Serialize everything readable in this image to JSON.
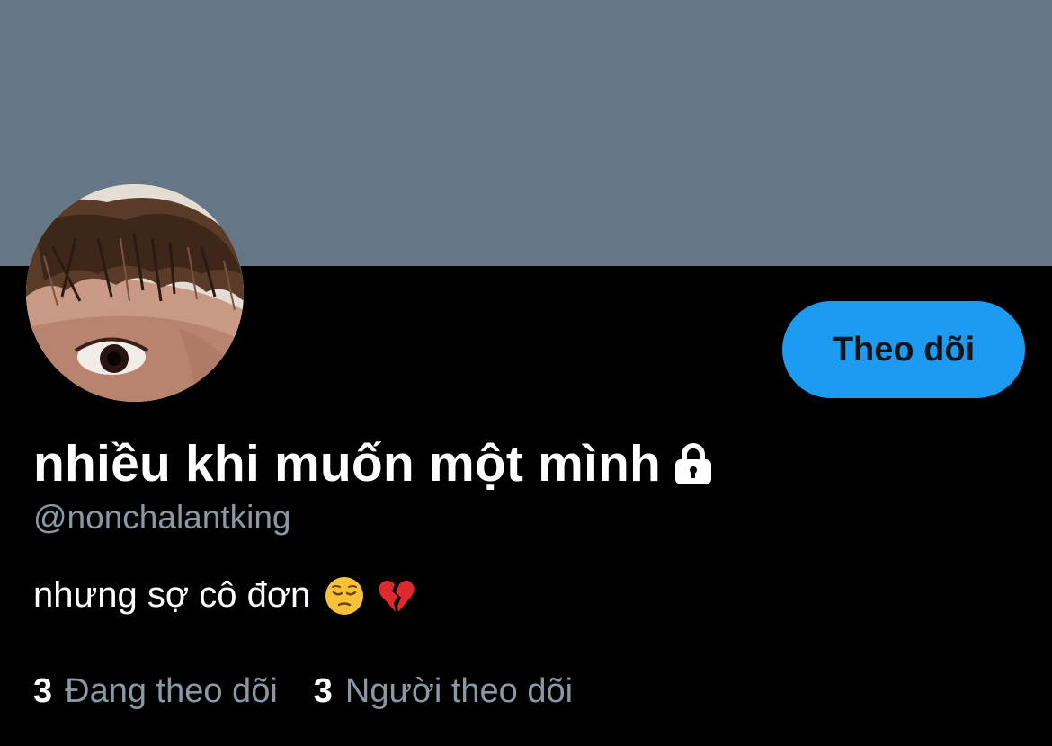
{
  "profile": {
    "display_name": "nhiều khi muốn một mình",
    "handle": "@nonchalantking",
    "bio": "nhưng sợ cô đơn",
    "bio_emojis": [
      "pensive-face-emoji",
      "broken-heart-emoji"
    ],
    "protected_icon": "lock-icon"
  },
  "actions": {
    "follow_label": "Theo dõi"
  },
  "stats": {
    "following_count": "3",
    "following_label": "Đang theo dõi",
    "followers_count": "3",
    "followers_label": "Người theo dõi"
  },
  "colors": {
    "banner": "#657786",
    "background": "#000000",
    "accent": "#1d9bf0",
    "secondary_text": "#8899a6"
  }
}
